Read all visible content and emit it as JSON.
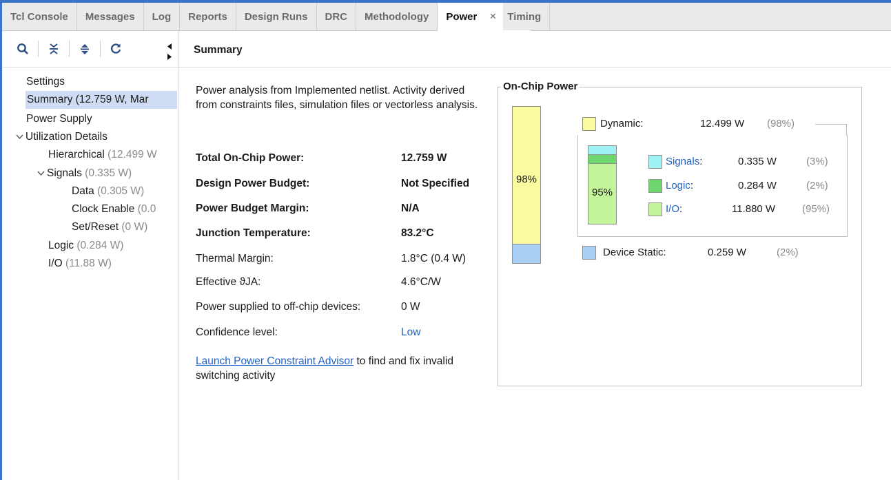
{
  "tabs": [
    {
      "label": "Tcl Console"
    },
    {
      "label": "Messages"
    },
    {
      "label": "Log"
    },
    {
      "label": "Reports"
    },
    {
      "label": "Design Runs"
    },
    {
      "label": "DRC"
    },
    {
      "label": "Methodology"
    },
    {
      "label": "Power",
      "active": true
    },
    {
      "label": "Timing"
    }
  ],
  "tab_close": "×",
  "toolbar": {
    "search": "search-icon",
    "collapse": "collapse-all-icon",
    "expand": "expand-all-icon",
    "refresh": "refresh-icon"
  },
  "tree": {
    "settings": "Settings",
    "summary": "Summary (12.759 W, Mar",
    "power_supply": "Power Supply",
    "utilization": "Utilization Details",
    "hierarchical": "Hierarchical",
    "hierarchical_val": "(12.499 W",
    "signals": "Signals",
    "signals_val": "(0.335 W)",
    "data": "Data",
    "data_val": "(0.305 W)",
    "clock_enable": "Clock Enable",
    "clock_enable_val": "(0.0",
    "set_reset": "Set/Reset",
    "set_reset_val": "(0 W)",
    "logic": "Logic",
    "logic_val": "(0.284 W)",
    "io": "I/O",
    "io_val": "(11.88 W)"
  },
  "summary": {
    "title": "Summary",
    "description": "Power analysis from Implemented netlist. Activity derived from constraints files, simulation files or vectorless analysis.",
    "rows": [
      {
        "label": "Total On-Chip Power:",
        "value": "12.759 W",
        "bold": true
      },
      {
        "label": "Design Power Budget:",
        "value": "Not Specified",
        "bold": true
      },
      {
        "label": "Power Budget Margin:",
        "value": "N/A",
        "bold": true
      },
      {
        "label": "Junction Temperature:",
        "value": "83.2°C",
        "bold": true
      },
      {
        "label": "Thermal Margin:",
        "value": "1.8°C (0.4 W)",
        "bold": false
      },
      {
        "label": "Effective ϑJA:",
        "value": "4.6°C/W",
        "bold": false
      },
      {
        "label": "Power supplied to off-chip devices:",
        "value": "0 W",
        "bold": false
      },
      {
        "label": "Confidence level:",
        "value": "Low",
        "bold": false,
        "link": true
      }
    ],
    "advisor_link": "Launch Power Constraint Advisor",
    "advisor_text": " to find and fix invalid switching activity"
  },
  "on_chip": {
    "title": "On-Chip Power",
    "bar_pct": "98%",
    "dynamic_fraction": 0.98,
    "static_fraction": 0.02,
    "dynamic": {
      "label": "Dynamic:",
      "value": "12.499 W",
      "pct": "(98%)",
      "color": "#fafaa0"
    },
    "signals": {
      "label": "Signals",
      "colon": ":",
      "value": "0.335 W",
      "pct": "(3%)",
      "color": "#9ff3f5"
    },
    "logic": {
      "label": "Logic",
      "colon": ":",
      "value": "0.284 W",
      "pct": "(2%)",
      "color": "#6fd66f"
    },
    "io": {
      "label": "I/O",
      "colon": ":",
      "value": "11.880 W",
      "pct": "(95%)",
      "color": "#c5f59a"
    },
    "sub_pct": "95%",
    "static": {
      "label": "Device Static:",
      "value": "0.259 W",
      "pct": "(2%)",
      "color": "#a9cff4"
    }
  }
}
